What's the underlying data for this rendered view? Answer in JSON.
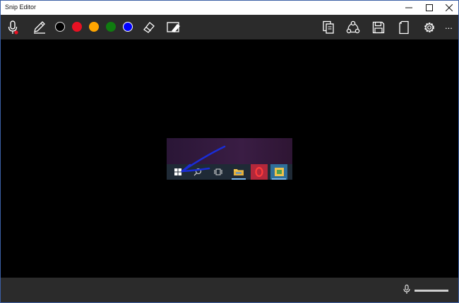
{
  "window": {
    "title": "Snip Editor"
  },
  "toolbar": {
    "colors": [
      "#000000",
      "#e81123",
      "#ffa500",
      "#107c10",
      "#0000ff"
    ],
    "more_label": "..."
  },
  "canvas": {
    "arrow_color": "#1a2dd6",
    "taskbar_icons": [
      "windows-start-icon",
      "search-icon",
      "task-view-icon",
      "file-explorer-icon",
      "opera-icon",
      "app-icon"
    ]
  },
  "bottombar": {
    "audio_level": 1.0
  },
  "colors": {
    "toolbar_bg": "#2b2b2b",
    "canvas_bg": "#000000",
    "titlebar_bg": "#ffffff",
    "window_border": "#3b5fa5"
  }
}
